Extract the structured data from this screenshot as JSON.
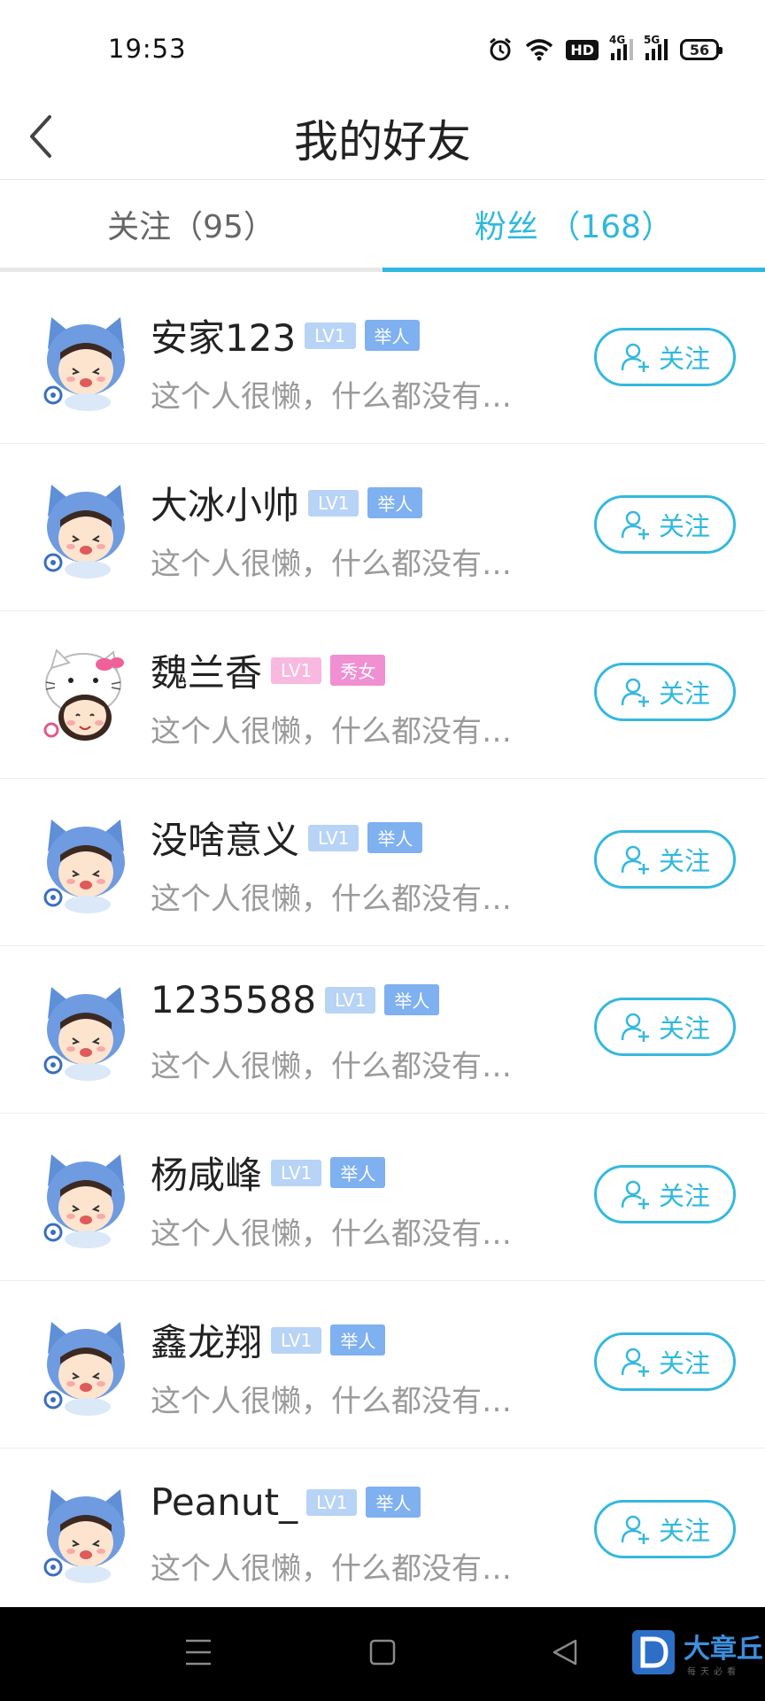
{
  "status_bar": {
    "time": "19:53",
    "hd": "HD",
    "net1": "4G",
    "net2": "5G",
    "battery": "56"
  },
  "header": {
    "title": "我的好友"
  },
  "tabs": [
    {
      "label": "关注（95）",
      "active": false
    },
    {
      "label": "粉丝 （168）",
      "active": true
    }
  ],
  "follow_label": "关注",
  "fans": [
    {
      "name": "安家123",
      "level": "LV1",
      "tag": "举人",
      "bio": "这个人很懒，什么都没有…",
      "avatar": "blue-cat-hood"
    },
    {
      "name": "大冰小帅",
      "level": "LV1",
      "tag": "举人",
      "bio": "这个人很懒，什么都没有…",
      "avatar": "blue-cat-hood"
    },
    {
      "name": "魏兰香",
      "level": "LV1",
      "tag": "秀女",
      "bio": "这个人很懒，什么都没有…",
      "avatar": "hello-kitty-girl"
    },
    {
      "name": "没啥意义",
      "level": "LV1",
      "tag": "举人",
      "bio": "这个人很懒，什么都没有…",
      "avatar": "blue-cat-hood"
    },
    {
      "name": "1235588",
      "level": "LV1",
      "tag": "举人",
      "bio": "这个人很懒，什么都没有…",
      "avatar": "blue-cat-hood"
    },
    {
      "name": "杨咸峰",
      "level": "LV1",
      "tag": "举人",
      "bio": "这个人很懒，什么都没有…",
      "avatar": "blue-cat-hood"
    },
    {
      "name": "鑫龙翔",
      "level": "LV1",
      "tag": "举人",
      "bio": "这个人很懒，什么都没有…",
      "avatar": "blue-cat-hood"
    },
    {
      "name": "Peanut_",
      "level": "LV1",
      "tag": "举人",
      "bio": "这个人很懒，什么都没有…",
      "avatar": "blue-cat-hood"
    }
  ],
  "watermark": {
    "text": "大章丘",
    "sub": "每天必看"
  },
  "colors": {
    "accent": "#2fb8de",
    "level_badge": "#b7d3f6",
    "rank_badge": "#7fb0ef",
    "female_badge": "#f08fd1"
  }
}
